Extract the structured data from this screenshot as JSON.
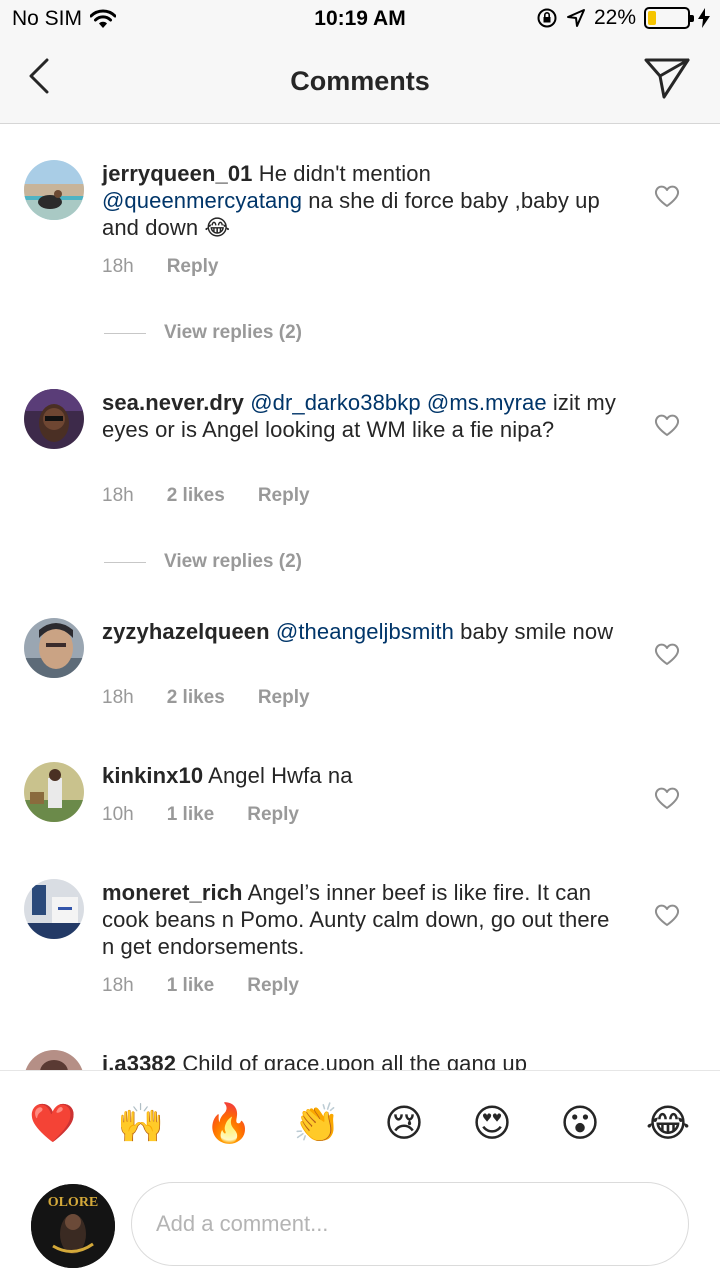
{
  "status_bar": {
    "carrier": "No SIM",
    "time": "10:19 AM",
    "battery": "22%",
    "battery_level": 0.22,
    "battery_color": "#f5c400"
  },
  "nav": {
    "title": "Comments",
    "back_icon": "chevron-left-icon",
    "share_icon": "paper-plane-icon"
  },
  "comments": [
    {
      "username": "jerryqueen_01",
      "text_before": " He didn't mention ",
      "mention": "@queenmercyatang",
      "text_after": " na she di force baby ,baby up and down 😂",
      "time": "18h",
      "likes": "",
      "reply": "Reply",
      "view_replies": "View replies (2)"
    },
    {
      "username": "sea.never.dry",
      "mention": "@dr_darko38bkp @ms.myrae",
      "text_after": " izit my eyes or is Angel looking at WM like a fie nipa?",
      "time": "18h",
      "likes": "2 likes",
      "reply": "Reply",
      "view_replies": "View replies (2)"
    },
    {
      "username": "zyzyhazelqueen",
      "mention": "@theangeljbsmith",
      "text_after": " baby smile now",
      "time": "18h",
      "likes": "2 likes",
      "reply": "Reply"
    },
    {
      "username": "kinkinx10",
      "text_after": " Angel Hwfa na",
      "time": "10h",
      "likes": "1 like",
      "reply": "Reply"
    },
    {
      "username": "moneret_rich",
      "text_after": " Angel’s inner beef is like fire. It can cook beans n Pomo. Aunty calm down, go out there n get endorsements.",
      "time": "18h",
      "likes": "1 like",
      "reply": "Reply"
    },
    {
      "username": "i.a3382",
      "text_after": " Child of grace,upon all the gang up"
    }
  ],
  "emoji_bar": [
    "❤️",
    "🙌",
    "🔥",
    "👏",
    "😢",
    "😍",
    "😮",
    "😂"
  ],
  "input": {
    "placeholder": "Add a comment...",
    "avatar_label": "OLORE"
  },
  "colors": {
    "mention": "#003569",
    "meta": "#999999",
    "text": "#262626"
  }
}
